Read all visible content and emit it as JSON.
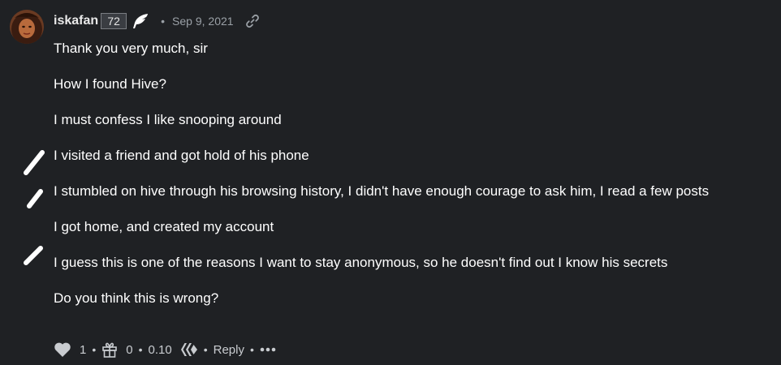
{
  "comment": {
    "author": "iskafan",
    "reputation": "72",
    "separator": "•",
    "date": "Sep 9, 2021",
    "icons": {
      "author_badge": "feather-icon",
      "permalink": "link-icon",
      "vote": "heart-icon",
      "reward": "gift-icon",
      "currency": "hive-logo-icon",
      "more": "more-icon"
    },
    "paragraphs": [
      "Thank you very much, sir",
      "How I found Hive?",
      "I must confess I like snooping around",
      "I visited a friend and got hold of his phone",
      "I stumbled on hive through his browsing history, I didn't have enough courage to ask him, I read a few posts",
      "I got home, and created my account",
      "I guess this is one of the reasons I want to stay anonymous, so he doesn't find out I know his secrets",
      "Do you think this is wrong?"
    ],
    "footer": {
      "votes": "1",
      "gifts": "0",
      "payout": "0.10",
      "reply": "Reply",
      "dot": "•"
    }
  },
  "colors": {
    "background": "#1f2124",
    "text": "#ffffff",
    "muted": "#9aa0a6",
    "badge_border": "#7a7d82"
  }
}
